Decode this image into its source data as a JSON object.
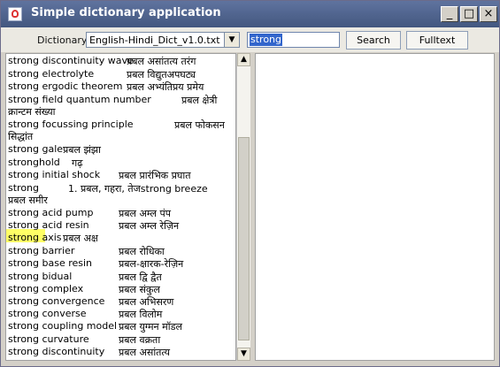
{
  "window": {
    "title": "Simple dictionary application",
    "controls": {
      "minimize": "_",
      "maximize": "□",
      "close": "×"
    }
  },
  "toolbar": {
    "dictionary_label": "Dictionary",
    "dictionary_value": "English-Hindi_Dict_v1.0.txt",
    "search_value": "strong",
    "search_button": "Search",
    "fulltext_button": "Fulltext"
  },
  "list": {
    "selected_word": "strong",
    "items": [
      {
        "word": "strong discontinuity wave",
        "meaning": "प्रबल असांतत्य तरंग"
      },
      {
        "word": "strong electrolyte",
        "meaning": "प्रबल विद्युतअपघट्य"
      },
      {
        "word": "strong ergodic theorem",
        "meaning": "प्रबल अभ्यंतिप्रय प्रमेय"
      },
      {
        "word": "strong field quantum number",
        "meaning": "प्रबल क्षेत्री",
        "meaning2": "क्रान्टम संख्या"
      },
      {
        "word": "strong focussing principle",
        "meaning": "प्रबल फोकसन",
        "meaning2": "सिद्धांत"
      },
      {
        "word": "strong gale",
        "meaning": "प्रबल झंझा"
      },
      {
        "word": "stronghold",
        "meaning": "गढ़"
      },
      {
        "word": "strong initial shock",
        "meaning": "प्रबल प्रारंभिक प्रघात"
      },
      {
        "word": "strong",
        "meaning": "1. प्रबल, गहरा, तेजstrong breeze",
        "meaning2": "प्रबल समीर"
      },
      {
        "word": "strong acid pump",
        "meaning": "प्रबल अम्ल पंप"
      },
      {
        "word": "strong acid resin",
        "meaning": "प्रबल अम्ल रेज़िन"
      },
      {
        "word": "strong axis",
        "meaning": "प्रबल अक्ष"
      },
      {
        "word": "strong barrier",
        "meaning": "प्रबल रोधिका"
      },
      {
        "word": "strong base resin",
        "meaning": "प्रबल-क्षारक-रेज़िन"
      },
      {
        "word": "strong bidual",
        "meaning": "प्रबल द्वि द्वैत"
      },
      {
        "word": "strong complex",
        "meaning": "प्रबल संकुल"
      },
      {
        "word": "strong convergence",
        "meaning": "प्रबल अभिसरण"
      },
      {
        "word": "strong converse",
        "meaning": "प्रबल विलोम"
      },
      {
        "word": "strong coupling model",
        "meaning": "प्रबल युग्मन मॉडल"
      },
      {
        "word": "strong curvature",
        "meaning": "प्रबल वक्रता"
      },
      {
        "word": "strong discontinuity",
        "meaning": "प्रबल असांतत्य"
      }
    ]
  },
  "detail": {
    "text": ""
  }
}
